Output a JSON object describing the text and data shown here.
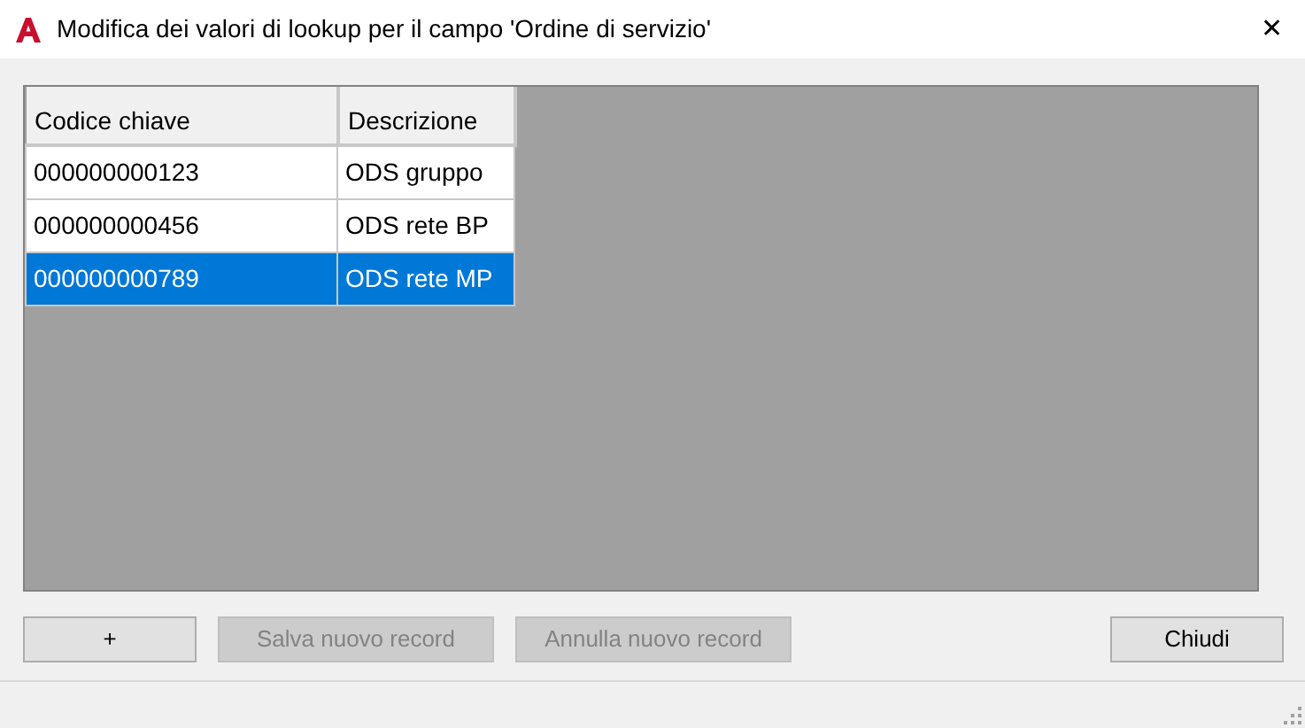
{
  "window": {
    "title": "Modifica dei valori di lookup per il campo 'Ordine di servizio'",
    "close": "✕"
  },
  "table": {
    "columns": [
      "Codice chiave",
      "Descrizione"
    ],
    "rows": [
      {
        "cells": [
          "000000000123",
          "ODS gruppo"
        ],
        "selected": false
      },
      {
        "cells": [
          "000000000456",
          "ODS rete BP"
        ],
        "selected": false
      },
      {
        "cells": [
          "000000000789",
          "ODS rete MP"
        ],
        "selected": true
      }
    ]
  },
  "buttons": [
    {
      "label": "+",
      "disabled": false
    },
    {
      "label": "Salva nuovo record",
      "disabled": true
    },
    {
      "label": "Annulla nuovo record",
      "disabled": true
    },
    {
      "label": "Chiudi",
      "disabled": false
    }
  ]
}
